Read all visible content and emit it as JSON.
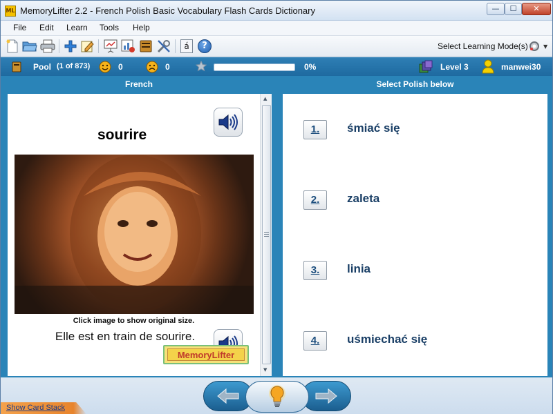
{
  "window": {
    "app_icon_text": "ML",
    "title": "MemoryLifter 2.2 - French Polish Basic Vocabulary Flash Cards Dictionary",
    "minimize_glyph": "—",
    "maximize_glyph": "☐",
    "close_glyph": "✕"
  },
  "menu": {
    "items": [
      "File",
      "Edit",
      "Learn",
      "Tools",
      "Help"
    ]
  },
  "toolbar": {
    "icons": [
      "new-document-icon",
      "open-folder-icon",
      "print-icon",
      "add-card-icon",
      "edit-card-icon",
      "presentation-icon",
      "chart-icon",
      "card-stack-icon",
      "settings-tools-icon",
      "special-characters-icon",
      "help-icon"
    ],
    "char_button_label": "á",
    "help_glyph": "?",
    "mode_label": "Select Learning Mode(s)"
  },
  "status": {
    "pool_label": "Pool",
    "pool_count": "(1 of 873)",
    "correct_count": "0",
    "wrong_count": "0",
    "progress_percent": 0,
    "progress_label": "0%",
    "level_label": "Level 3",
    "user_name": "manwei30"
  },
  "columns": {
    "left_header": "French",
    "right_header": "Select Polish below"
  },
  "card": {
    "word": "sourire",
    "image_caption": "Click image to show original size.",
    "example_sentence": "Elle est en train de sourire.",
    "watermark_text": "MemoryLifter"
  },
  "answers": [
    {
      "number": "1.",
      "text": "śmiać się"
    },
    {
      "number": "2.",
      "text": "zaleta"
    },
    {
      "number": "3.",
      "text": "linia"
    },
    {
      "number": "4.",
      "text": "uśmiechać się"
    }
  ],
  "bottom": {
    "show_card_stack": "Show Card Stack"
  },
  "colors": {
    "accent_blue": "#2a84b8",
    "answer_text": "#1a3f66",
    "status_text": "#ffffff"
  }
}
